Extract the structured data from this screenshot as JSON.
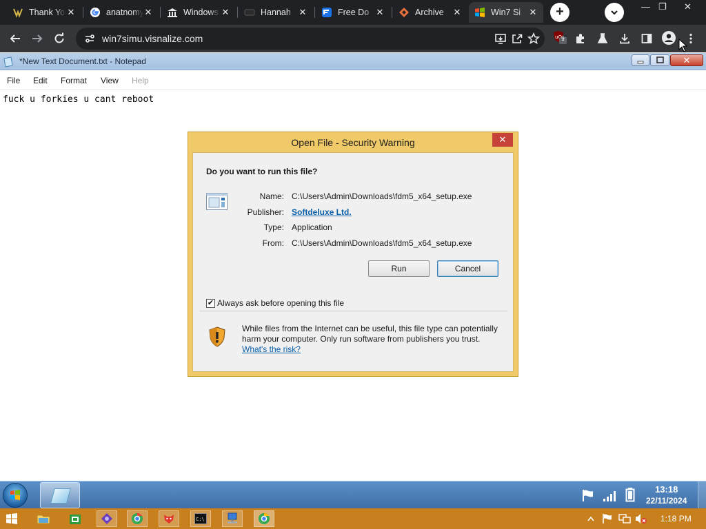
{
  "browser": {
    "tabs": [
      {
        "title": "Thank You",
        "active": false
      },
      {
        "title": "anatnomy",
        "active": false
      },
      {
        "title": "Windows",
        "active": false
      },
      {
        "title": "Hannah",
        "active": false
      },
      {
        "title": "Free Do",
        "active": false
      },
      {
        "title": "Archive",
        "active": false
      },
      {
        "title": "Win7 Si",
        "active": true
      }
    ],
    "close_glyph": "✕",
    "new_tab_glyph": "+",
    "url": "win7simu.visnalize.com",
    "extension_badge": "9",
    "window_controls": [
      "—",
      "❐",
      "✕"
    ]
  },
  "notepad": {
    "title": "*New Text Document.txt - Notepad",
    "menu": [
      "File",
      "Edit",
      "Format",
      "View",
      "Help"
    ],
    "content": "fuck u forkies u cant reboot",
    "close_glyph": "✕"
  },
  "dialog": {
    "title": "Open File - Security Warning",
    "close_glyph": "✕",
    "question": "Do you want to run this file?",
    "fields": [
      {
        "label": "Name:",
        "value": "C:\\Users\\Admin\\Downloads\\fdm5_x64_setup.exe"
      },
      {
        "label": "Publisher:",
        "value": "Softdeluxe Ltd."
      },
      {
        "label": "Type:",
        "value": "Application"
      },
      {
        "label": "From:",
        "value": "C:\\Users\\Admin\\Downloads\\fdm5_x64_setup.exe"
      }
    ],
    "run_label": "Run",
    "cancel_label": "Cancel",
    "checkbox_label": "Always ask before opening this file",
    "checkbox_checked": true,
    "check_glyph": "✔",
    "warning_text": "While files from the Internet can be useful, this file type can potentially harm your computer. Only run software from publishers you trust.",
    "risk_link": "What's the risk?"
  },
  "win7_taskbar": {
    "time": "13:18",
    "date": "22/11/2024"
  },
  "host_taskbar": {
    "time": "1:18 PM"
  },
  "colors": {
    "chrome_dark": "#202124",
    "chrome_toolbar": "#35363a",
    "dialog_frame": "#f0c968",
    "link_blue": "#0a5fa8",
    "host_taskbar": "#c8801f"
  }
}
